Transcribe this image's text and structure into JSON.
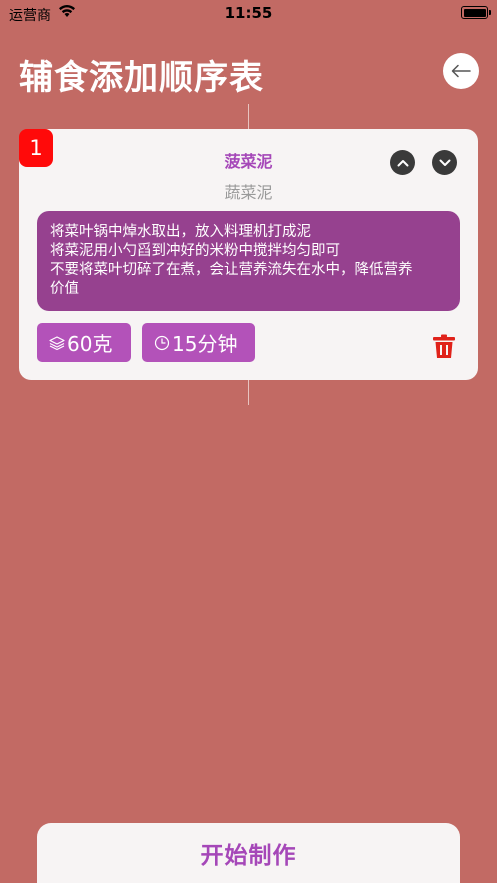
{
  "status_bar": {
    "carrier": "运营商",
    "time": "11:55"
  },
  "header": {
    "title": "辅食添加顺序表",
    "back_icon": "arrow-left-icon"
  },
  "colors": {
    "background": "#c26a64",
    "accent": "#a547b8",
    "badge": "#ff0a0a",
    "delete": "#e0221a"
  },
  "items": [
    {
      "index": "1",
      "name": "菠菜泥",
      "category": "蔬菜泥",
      "steps": [
        "将菜叶锅中焯水取出，放入料理机打成泥",
        "将菜泥用小勺舀到冲好的米粉中搅拌均匀即可",
        "不要将菜叶切碎了在煮，会让营养流失在水中，降低营养",
        "价值"
      ],
      "weight": "60克",
      "time": "15分钟"
    }
  ],
  "footer": {
    "start_label": "开始制作"
  }
}
